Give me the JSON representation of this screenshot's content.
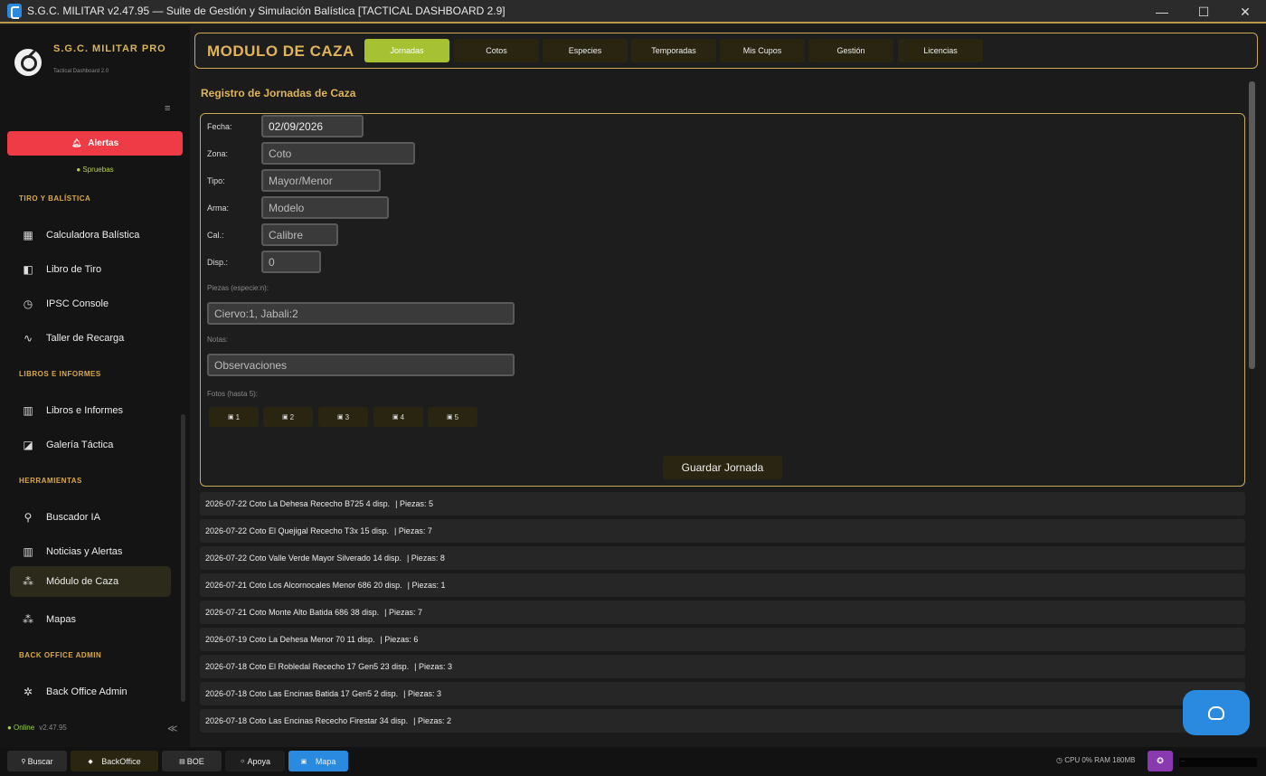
{
  "window": {
    "title": "S.G.C. MILITAR v2.47.95 — Suite de Gestión y Simulación Balística [TACTICAL DASHBOARD 2.9]",
    "minimize": "—",
    "maximize": "☐",
    "close": "✕"
  },
  "sidebar": {
    "brand": "S.G.C. MILITAR PRO",
    "brand_sub": "Tactical Dashboard 2.0",
    "menu_glyph": "≡",
    "alert_label": "Alertas",
    "status": "● Spruebas",
    "sections": {
      "tiro": "TIRO Y BALÍSTICA",
      "libros": "LIBROS E INFORMES",
      "herramientas": "HERRAMIENTAS",
      "backoffice": "BACK OFFICE ADMIN"
    },
    "items": {
      "calculadora": "Calculadora Balística",
      "libro_tiro": "Libro de Tiro",
      "ipsc": "IPSC Console",
      "taller": "Taller de Recarga",
      "libros_informes": "Libros e Informes",
      "galeria": "Galería Táctica",
      "buscador": "Buscador IA",
      "noticias": "Noticias y Alertas",
      "caza": "Módulo de Caza",
      "mapas": "Mapas",
      "backoffice": "Back Office Admin"
    },
    "footer_status": "● Online",
    "footer_version": "v2.47.95",
    "collapse_glyph": "≪"
  },
  "module": {
    "title": "MODULO DE CAZA",
    "tabs": [
      "Jornadas",
      "Cotos",
      "Especies",
      "Temporadas",
      "Mis Cupos",
      "Gestión",
      "Licencias"
    ],
    "active_tab": "Jornadas"
  },
  "form": {
    "heading": "Registro de Jornadas de Caza",
    "fecha_label": "Fecha:",
    "fecha_value": "02/09/2026",
    "zona_label": "Zona:",
    "zona_placeholder": "Coto",
    "tipo_label": "Tipo:",
    "tipo_placeholder": "Mayor/Menor",
    "arma_label": "Arma:",
    "arma_placeholder": "Modelo",
    "cal_label": "Cal.:",
    "cal_placeholder": "Calibre",
    "disp_label": "Disp.:",
    "disp_placeholder": "0",
    "piezas_hint": "Piezas (especie:n):",
    "piezas_placeholder": "Ciervo:1, Jabali:2",
    "notas_hint": "Notas:",
    "notas_placeholder": "Observaciones",
    "fotos_hint": "Fotos (hasta 5):",
    "photo_slots": [
      "1",
      "2",
      "3",
      "4",
      "5"
    ],
    "save_label": "Guardar Jornada"
  },
  "jornadas": [
    {
      "text": "2026-07-22  Coto La Dehesa  Rececho  B725  4 disp.",
      "piezas": "|  Piezas: 5"
    },
    {
      "text": "2026-07-22  Coto El Quejigal  Rececho  T3x  15 disp.",
      "piezas": "|  Piezas: 7"
    },
    {
      "text": "2026-07-22  Coto Valle Verde  Mayor  Silverado  14 disp.",
      "piezas": "|  Piezas: 8"
    },
    {
      "text": "2026-07-21  Coto Los Alcornocales  Menor  686  20 disp.",
      "piezas": "|  Piezas: 1"
    },
    {
      "text": "2026-07-21  Coto Monte Alto  Batida  686  38 disp.",
      "piezas": "|  Piezas: 7"
    },
    {
      "text": "2026-07-19  Coto La Dehesa  Menor  70  11 disp.",
      "piezas": "|  Piezas: 6"
    },
    {
      "text": "2026-07-18  Coto El Robledal  Rececho  17 Gen5  23 disp.",
      "piezas": "|  Piezas: 3"
    },
    {
      "text": "2026-07-18  Coto Las Encinas  Batida  17 Gen5  2 disp.",
      "piezas": "|  Piezas: 3"
    },
    {
      "text": "2026-07-18  Coto Las Encinas  Rececho  Firestar  34 disp.",
      "piezas": "|  Piezas: 2"
    }
  ],
  "taskbar": {
    "buscar": "Buscar",
    "backoffice": "BackOffice",
    "boe": "BOE",
    "apoya": "Apoya",
    "mapa": "Mapa",
    "status": "CPU 0%  RAM 180MB",
    "tray_text": "..."
  },
  "colors": {
    "accent_gold": "#e0b458",
    "active_tab": "#a6c233",
    "alert_red": "#ee3b45",
    "blue": "#2a8ae0",
    "purple": "#8a3ab0"
  }
}
